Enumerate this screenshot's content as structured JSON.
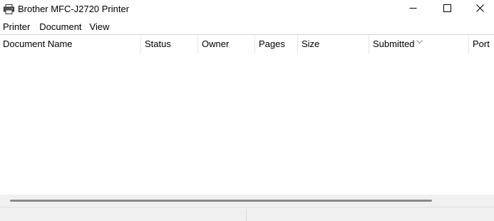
{
  "window": {
    "title": "Brother MFC-J2720 Printer",
    "icon": "printer-icon",
    "controls": [
      "minimize-icon",
      "maximize-icon",
      "close-icon"
    ]
  },
  "menu": {
    "items": [
      {
        "label": "Printer"
      },
      {
        "label": "Document"
      },
      {
        "label": "View"
      }
    ]
  },
  "queue": {
    "columns": [
      {
        "label": "Document Name"
      },
      {
        "label": "Status"
      },
      {
        "label": "Owner"
      },
      {
        "label": "Pages"
      },
      {
        "label": "Size"
      },
      {
        "label": "Submitted",
        "sorted": "descending"
      },
      {
        "label": "Port"
      }
    ],
    "rows": []
  },
  "statusbar": {
    "panes": [
      "",
      ""
    ]
  }
}
